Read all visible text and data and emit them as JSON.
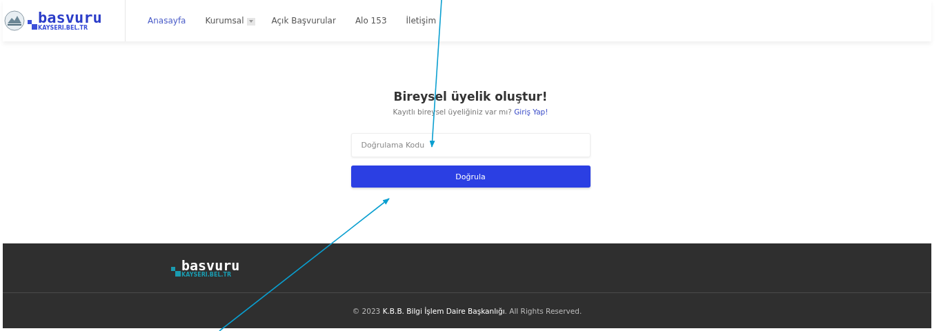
{
  "header": {
    "logo": {
      "word": "basvuru",
      "domain": "KAYSERI.BEL.TR"
    },
    "nav": [
      {
        "label": "Anasayfa",
        "selected": true,
        "dropdown": false
      },
      {
        "label": "Kurumsal",
        "selected": false,
        "dropdown": true
      },
      {
        "label": "Açık Başvurular",
        "selected": false,
        "dropdown": false
      },
      {
        "label": "Alo 153",
        "selected": false,
        "dropdown": false
      },
      {
        "label": "İletişim",
        "selected": false,
        "dropdown": false
      }
    ]
  },
  "form": {
    "title": "Bireysel üyelik oluştur!",
    "subtitle": "Kayıtlı bireysel üyeliğiniz var mı?",
    "link": "Giriş Yap!",
    "code_field": {
      "placeholder": "Doğrulama Kodu"
    },
    "submit": "Doğrula"
  },
  "footer": {
    "logo": {
      "word": "basvuru",
      "domain": "KAYSERI.BEL.TR"
    },
    "copyright": "© 2023 **K.B.B. Bilgi İşlem Daire Başkanlığı**. All Rights Reserved."
  },
  "annotations": [
    {
      "kind": "arrow"
    },
    {
      "kind": "arrow"
    }
  ]
}
